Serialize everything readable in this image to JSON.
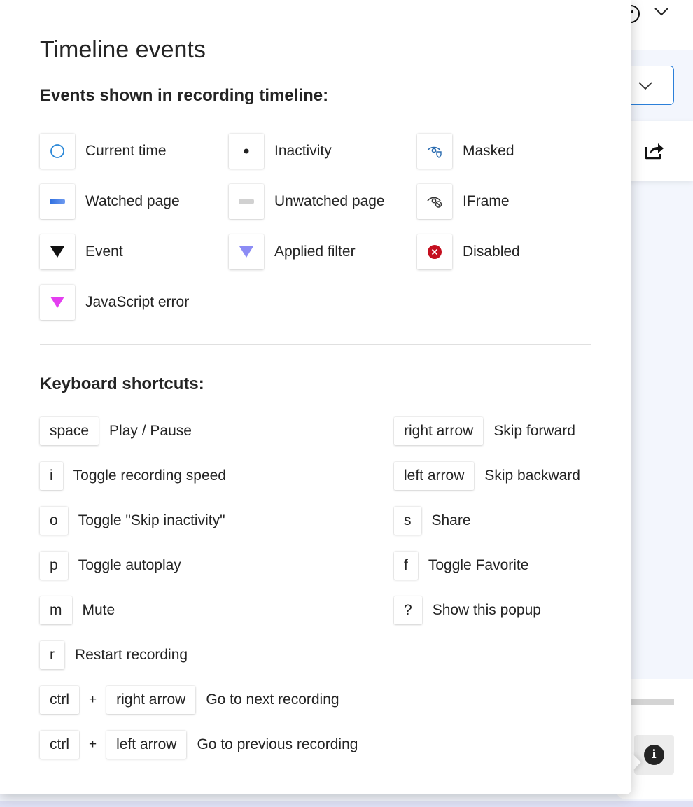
{
  "popup": {
    "title": "Timeline events",
    "events_heading": "Events shown in recording timeline:",
    "shortcuts_heading": "Keyboard shortcuts:"
  },
  "events": [
    {
      "label": "Current time",
      "icon": "current-time-ring-icon"
    },
    {
      "label": "Inactivity",
      "icon": "inactivity-dot-icon"
    },
    {
      "label": "Masked",
      "icon": "masked-eye-icon"
    },
    {
      "label": "Watched page",
      "icon": "watched-page-bar-icon"
    },
    {
      "label": "Unwatched page",
      "icon": "unwatched-page-bar-icon"
    },
    {
      "label": "IFrame",
      "icon": "iframe-eye-icon"
    },
    {
      "label": "Event",
      "icon": "event-triangle-icon"
    },
    {
      "label": "Applied filter",
      "icon": "applied-filter-triangle-icon"
    },
    {
      "label": "Disabled",
      "icon": "disabled-x-icon"
    },
    {
      "label": "JavaScript error",
      "icon": "javascript-error-triangle-icon"
    }
  ],
  "shortcuts": [
    {
      "keys": [
        "space"
      ],
      "label": "Play / Pause"
    },
    {
      "keys": [
        "i"
      ],
      "label": "Toggle recording speed"
    },
    {
      "keys": [
        "o"
      ],
      "label": "Toggle \"Skip inactivity\""
    },
    {
      "keys": [
        "p"
      ],
      "label": "Toggle autoplay"
    },
    {
      "keys": [
        "m"
      ],
      "label": "Mute"
    },
    {
      "keys": [
        "r"
      ],
      "label": "Restart recording"
    },
    {
      "keys": [
        "ctrl",
        "right arrow"
      ],
      "label": "Go to next recording"
    },
    {
      "keys": [
        "ctrl",
        "left arrow"
      ],
      "label": "Go to previous recording"
    },
    {
      "keys": [
        "right arrow"
      ],
      "label": "Skip forward"
    },
    {
      "keys": [
        "left arrow"
      ],
      "label": "Skip backward"
    },
    {
      "keys": [
        "s"
      ],
      "label": "Share"
    },
    {
      "keys": [
        "f"
      ],
      "label": "Toggle Favorite"
    },
    {
      "keys": [
        "?"
      ],
      "label": "Show this popup"
    }
  ],
  "shortcut_joiner": "+",
  "background": {
    "info_glyph": "i",
    "icons": [
      "face-icon",
      "chevron-down-icon",
      "share-icon",
      "info-icon"
    ]
  },
  "colors": {
    "current_time": "#2b88d8",
    "watched": "#4f7fe8",
    "unwatched": "#d1d1d1",
    "event": "#111111",
    "applied_filter": "#8c8cf5",
    "disabled": "#c50f1f",
    "javascript_error": "#e43ef0",
    "masked_eye": "#2b6cb0"
  }
}
